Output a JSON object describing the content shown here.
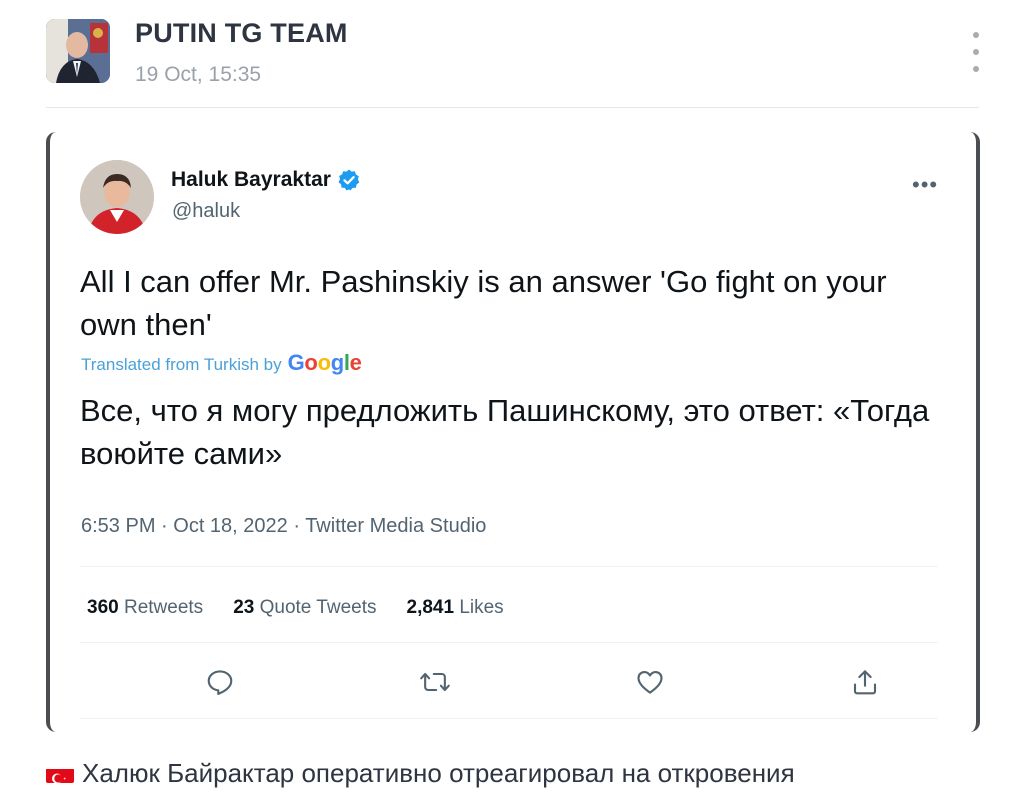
{
  "post": {
    "channel_name": "PUTIN TG TEAM",
    "date": "19 Oct, 15:35",
    "avatar_icon": "channel-avatar-photo",
    "menu_icon": "more-vertical-icon"
  },
  "tweet": {
    "author_name": "Haluk Bayraktar",
    "handle": "@haluk",
    "verified": true,
    "more_label": "•••",
    "text": "All I can offer Mr. Pashinskiy is an answer 'Go fight on your own then'",
    "translated_label": "Translated from Turkish by",
    "translation_provider": "Google",
    "translated_text": "Все, что я могу предложить Пашинскому, это ответ: «Тогда воюйте сами»",
    "meta": "6:53 PM · Oct 18, 2022 · Twitter Media Studio",
    "stats": [
      {
        "count": "360",
        "label": "Retweets"
      },
      {
        "count": "23",
        "label": "Quote Tweets"
      },
      {
        "count": "2,841",
        "label": "Likes"
      }
    ],
    "actions": [
      "reply-icon",
      "retweet-icon",
      "like-icon",
      "share-icon"
    ]
  },
  "caption": {
    "flag_icon": "turkey-flag-icon",
    "text": "Халюк Байрактар оперативно отреагировал на откровения"
  },
  "colors": {
    "twitter_text": "#0f1419",
    "twitter_secondary": "#536471",
    "verified_blue": "#1d9bf0",
    "translate_blue": "#4aa1d8",
    "flag_red": "#e30a17"
  }
}
